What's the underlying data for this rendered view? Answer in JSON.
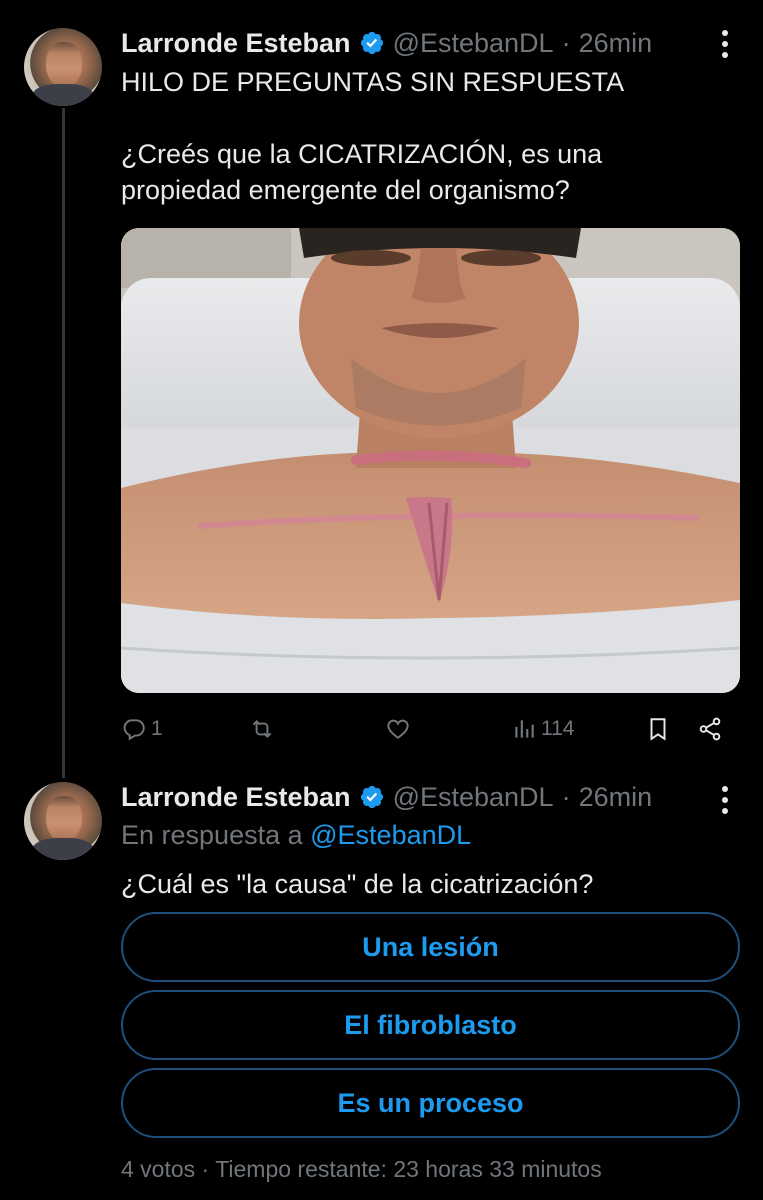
{
  "tweet1": {
    "author_name": "Larronde Esteban",
    "handle": "@EstebanDL",
    "separator": "·",
    "time": "26min",
    "text_line1": "HILO DE PREGUNTAS SIN RESPUESTA",
    "text_line2": "¿Creés que la CICATRIZACIÓN, es una",
    "text_line3": "propiedad emergente del organismo?",
    "actions": {
      "replies": "1",
      "retweets": "",
      "likes": "",
      "views": "114"
    }
  },
  "tweet2": {
    "author_name": "Larronde Esteban",
    "handle": "@EstebanDL",
    "separator": "·",
    "time": "26min",
    "reply_prefix": "En respuesta a",
    "reply_handle": "@EstebanDL",
    "text": "¿Cuál es \"la causa\" de la cicatrización?",
    "poll": {
      "options": [
        "Una lesión",
        "El fibroblasto",
        "Es un proceso"
      ],
      "votes": "4 votos",
      "separator": "·",
      "remaining": "Tiempo restante: 23 horas 33 minutos"
    }
  },
  "colors": {
    "background": "#000000",
    "text": "#e7e9ea",
    "secondary": "#71767b",
    "accent": "#1d9bf0",
    "verified": "#1d9bf0"
  },
  "icons": {
    "reply": "reply-icon",
    "retweet": "retweet-icon",
    "like": "heart-icon",
    "views": "views-icon",
    "bookmark": "bookmark-icon",
    "share": "share-icon",
    "more": "more-icon",
    "verified": "verified-badge-icon"
  }
}
